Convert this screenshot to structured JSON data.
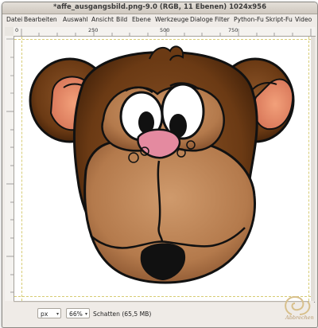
{
  "window": {
    "title": "*affe_ausgangsbild.png-9.0 (RGB, 11 Ebenen) 1024x956"
  },
  "menubar": {
    "items": [
      "Datei",
      "Bearbeiten",
      "Auswahl",
      "Ansicht",
      "Bild",
      "Ebene",
      "Werkzeuge",
      "Dialoge",
      "Filter",
      "Python-Fu",
      "Skript-Fu",
      "Video"
    ]
  },
  "ruler": {
    "labels": [
      "0",
      "250",
      "500",
      "750"
    ]
  },
  "status": {
    "unit": "px",
    "zoom": "66%",
    "message": "Schatten (65,5 MB)"
  },
  "watermark": {
    "text": "Abbrechen"
  },
  "icons": {
    "navigate": "navigate-icon",
    "quickmask": "quick-mask-icon"
  }
}
